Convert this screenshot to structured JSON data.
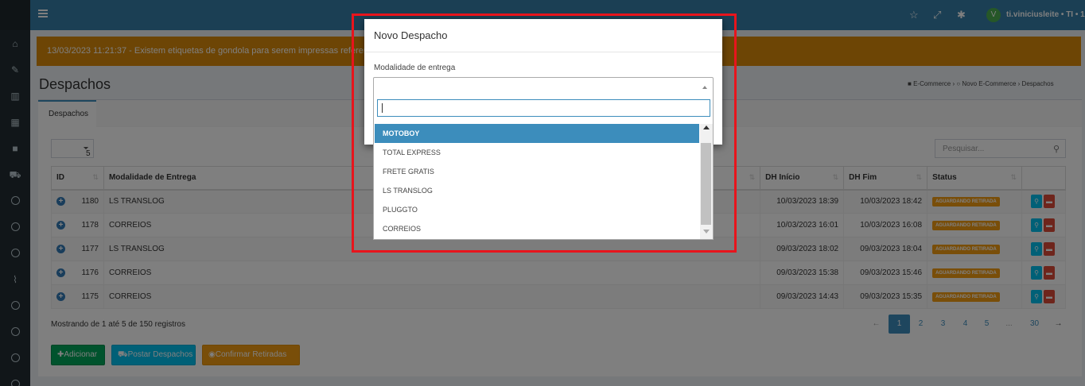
{
  "topbar": {
    "username": "ti.viniciusleite • TI • 1",
    "avatar_letter": "V"
  },
  "alert": {
    "text": "13/03/2023 11:21:37 - Existem etiquetas de gondola para serem impressas referente a alterações de preço."
  },
  "page": {
    "title": "Despachos"
  },
  "breadcrumb": {
    "item1": "E-Commerce",
    "item2": "Novo E-Commerce",
    "item3": "Despachos"
  },
  "tabs": {
    "active": "Despachos"
  },
  "table_controls": {
    "page_size": "5",
    "search_placeholder": "Pesquisar..."
  },
  "table": {
    "headers": {
      "id": "ID",
      "modalidade": "Modalidade de Entrega",
      "dh_inicio": "DH Início",
      "dh_fim": "DH Fim",
      "status": "Status"
    },
    "rows": [
      {
        "id": "1180",
        "modalidade": "LS TRANSLOG",
        "dh_inicio": "10/03/2023 18:39",
        "dh_fim": "10/03/2023 18:42",
        "status": "AGUARDANDO RETIRADA"
      },
      {
        "id": "1178",
        "modalidade": "CORREIOS",
        "dh_inicio": "10/03/2023 16:01",
        "dh_fim": "10/03/2023 16:08",
        "status": "AGUARDANDO RETIRADA"
      },
      {
        "id": "1177",
        "modalidade": "LS TRANSLOG",
        "dh_inicio": "09/03/2023 18:02",
        "dh_fim": "09/03/2023 18:04",
        "status": "AGUARDANDO RETIRADA"
      },
      {
        "id": "1176",
        "modalidade": "CORREIOS",
        "dh_inicio": "09/03/2023 15:38",
        "dh_fim": "09/03/2023 15:46",
        "status": "AGUARDANDO RETIRADA"
      },
      {
        "id": "1175",
        "modalidade": "CORREIOS",
        "dh_inicio": "09/03/2023 14:43",
        "dh_fim": "09/03/2023 15:35",
        "status": "AGUARDANDO RETIRADA"
      }
    ]
  },
  "footer": {
    "info": "Mostrando de 1 até 5 de 150 registros"
  },
  "pagination": {
    "prev": "←",
    "pages": [
      "1",
      "2",
      "3",
      "4",
      "5",
      "...",
      "30"
    ],
    "next": "→"
  },
  "actions": {
    "add": "Adicionar",
    "post": "Postar Despachos",
    "confirm": "Confirmar Retiradas"
  },
  "modal": {
    "title": "Novo Despacho",
    "field_label": "Modalidade de entrega",
    "options": [
      "MOTOBOY",
      "TOTAL EXPRESS",
      "FRETE GRATIS",
      "LS TRANSLOG",
      "PLUGGTO",
      "CORREIOS"
    ]
  },
  "colors": {
    "header": "#367fa9",
    "sidebar": "#222d32",
    "alert": "#db8b0b",
    "accent": "#3c8dbc",
    "badge": "#f39c12",
    "highlight_box": "#e8141c"
  }
}
